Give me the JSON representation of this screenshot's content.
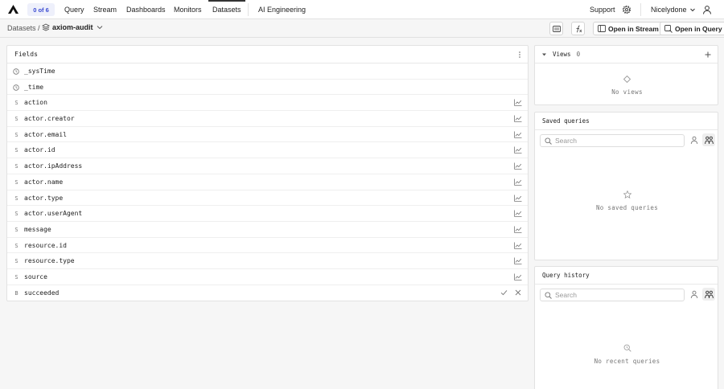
{
  "topbar": {
    "badge": "0 of 6",
    "nav": [
      {
        "label": "Query",
        "active": false
      },
      {
        "label": "Stream",
        "active": false
      },
      {
        "label": "Dashboards",
        "active": false
      },
      {
        "label": "Monitors",
        "active": false
      },
      {
        "label": "Datasets",
        "active": true
      }
    ],
    "ai_label": "AI Engineering",
    "support_label": "Support",
    "org_label": "Nicelydone"
  },
  "breadcrumb": {
    "root": "Datasets /",
    "dataset": "axiom-audit"
  },
  "toolbar": {
    "open_stream": "Open in Stream",
    "open_query": "Open in Query"
  },
  "fields": {
    "title": "Fields",
    "rows": [
      {
        "type": "time",
        "name": "_sysTime"
      },
      {
        "type": "time",
        "name": "_time"
      },
      {
        "type": "S",
        "name": "action"
      },
      {
        "type": "S",
        "name": "actor.creator"
      },
      {
        "type": "S",
        "name": "actor.email"
      },
      {
        "type": "S",
        "name": "actor.id"
      },
      {
        "type": "S",
        "name": "actor.ipAddress"
      },
      {
        "type": "S",
        "name": "actor.name"
      },
      {
        "type": "S",
        "name": "actor.type"
      },
      {
        "type": "S",
        "name": "actor.userAgent"
      },
      {
        "type": "S",
        "name": "message"
      },
      {
        "type": "S",
        "name": "resource.id"
      },
      {
        "type": "S",
        "name": "resource.type"
      },
      {
        "type": "S",
        "name": "source"
      },
      {
        "type": "B",
        "name": "succeeded"
      }
    ]
  },
  "views": {
    "title": "Views",
    "count": "0",
    "empty": "No views"
  },
  "saved": {
    "title": "Saved queries",
    "search_placeholder": "Search",
    "empty": "No saved queries"
  },
  "history": {
    "title": "Query history",
    "search_placeholder": "Search",
    "empty": "No recent queries"
  },
  "colors": {
    "badge_text": "#3a4ad1",
    "badge_bg": "#eef0fb",
    "border": "#e2e2e2"
  }
}
